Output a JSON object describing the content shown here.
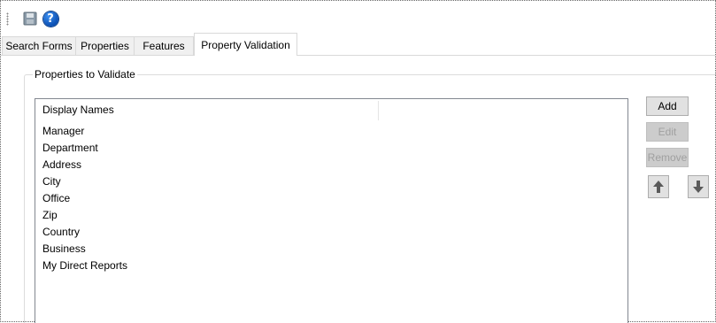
{
  "toolbar": {
    "save_icon": "save-icon",
    "help_icon": "help-icon",
    "help_glyph": "?"
  },
  "tabs": [
    {
      "label": "Search Forms",
      "active": false
    },
    {
      "label": "Properties",
      "active": false
    },
    {
      "label": "Features",
      "active": false
    },
    {
      "label": "Property Validation",
      "active": true
    }
  ],
  "group": {
    "title": "Properties to Validate"
  },
  "list": {
    "columns": [
      "Display Names",
      ""
    ],
    "rows": [
      "Manager",
      "Department",
      "Address",
      "City",
      "Office",
      "Zip",
      "Country",
      "Business",
      "My Direct Reports"
    ]
  },
  "buttons": {
    "add": "Add",
    "edit": "Edit",
    "remove": "Remove",
    "move_up_icon": "arrow-up-icon",
    "move_down_icon": "arrow-down-icon"
  },
  "colors": {
    "tab_inactive_bg": "#f0f0f0",
    "button_bg": "#e1e1e1",
    "disabled_button_bg": "#cccccc",
    "disabled_text": "#a0a0a0",
    "help_blue": "#0a4fb3"
  }
}
